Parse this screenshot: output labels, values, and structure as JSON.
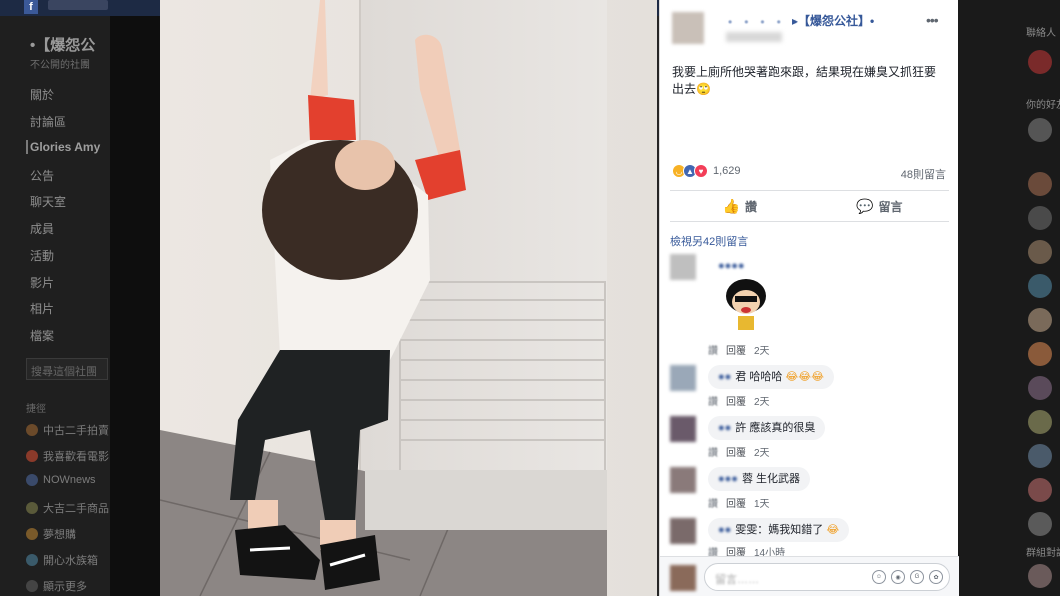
{
  "leftnav": {
    "group_title": "•【爆怨公",
    "group_sub": "不公開的社團",
    "items": [
      "關於",
      "討論區",
      "Glories Amy",
      "公告",
      "聊天室",
      "成員",
      "活動",
      "影片",
      "相片",
      "檔案"
    ],
    "search_placeholder": "搜尋這個社團",
    "shortcuts_title": "捷徑",
    "shortcuts": [
      "中古二手拍賣",
      "我喜歡看電影",
      "NOWnews",
      "大吉二手商品",
      "夢想購",
      "開心水族箱",
      "顯示更多"
    ]
  },
  "right_sidebar": {
    "header1": "聯絡人",
    "header2": "你的好友",
    "header3": "群組對話"
  },
  "post": {
    "author": "　•　•　•　•　•",
    "group": "▸【爆怨公社】•",
    "more_icon": "more-horizontal-icon",
    "text": "我要上廁所他哭著跑來跟，結果現在嫌臭又抓狂要出去",
    "text_emoji": "🙄",
    "reaction_count": "1,629",
    "comment_count": "48則留言",
    "like_label": "讚",
    "comment_label": "留言",
    "more_comments": "檢視另42則留言"
  },
  "comments": [
    {
      "name": "●●●●",
      "text": "",
      "like": "讚",
      "reply": "回覆",
      "time": "2天",
      "has_sticker": true
    },
    {
      "name": "●●",
      "text": "君 哈哈哈",
      "emoji": "😂😂😂",
      "like": "讚",
      "reply": "回覆",
      "time": "2天"
    },
    {
      "name": "●●",
      "text": "許 應該真的很臭",
      "emoji": "",
      "like": "讚",
      "reply": "回覆",
      "time": "2天"
    },
    {
      "name": "●●●",
      "text": "蓉 生化武器",
      "emoji": "",
      "like": "讚",
      "reply": "回覆",
      "time": "1天"
    },
    {
      "name": "●●",
      "text": "雯雯：媽我知錯了",
      "emoji": "😂",
      "like": "讚",
      "reply": "回覆",
      "time": "14小時"
    }
  ],
  "composer": {
    "placeholder": "留言……"
  }
}
